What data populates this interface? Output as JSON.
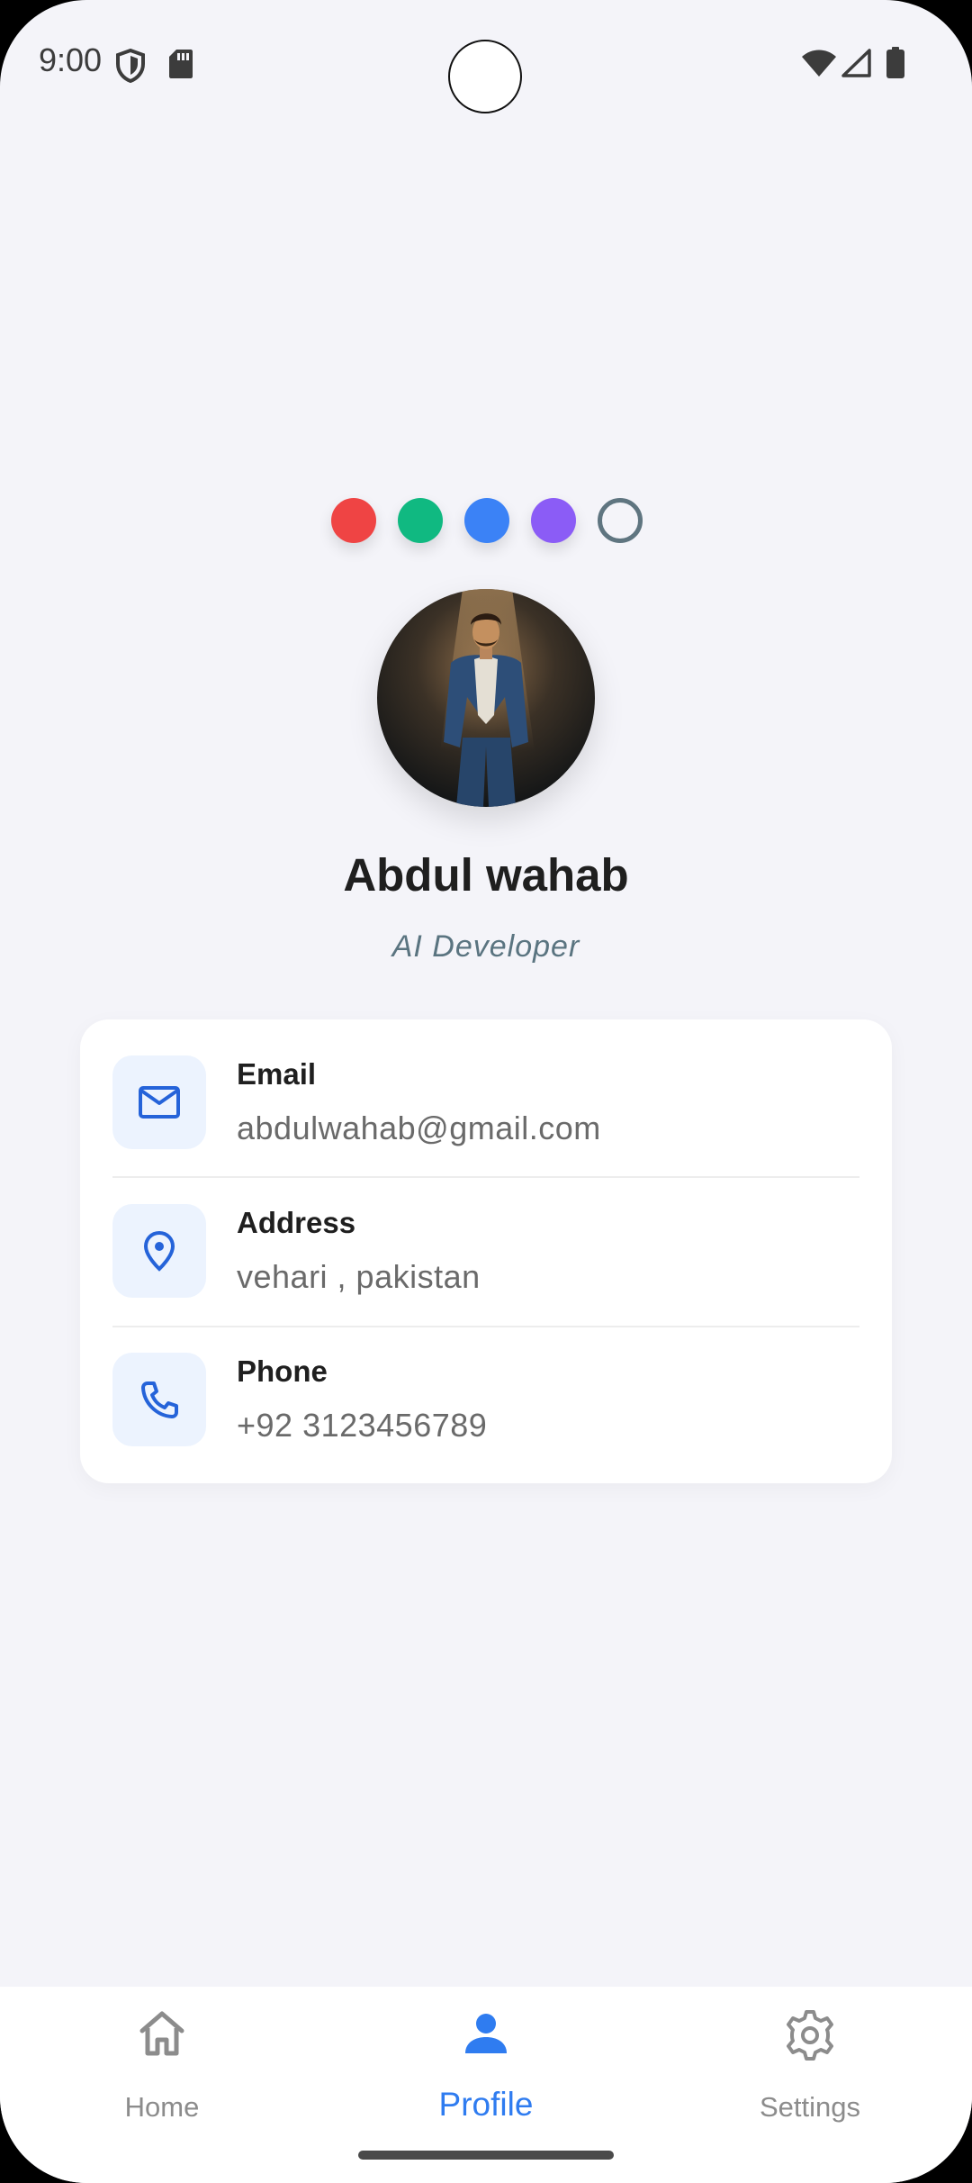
{
  "status_bar": {
    "time": "9:00",
    "left_icons": [
      "shield-icon",
      "sd-card-icon"
    ],
    "right_icons": [
      "wifi-icon",
      "signal-icon",
      "battery-icon"
    ]
  },
  "theme_colors": [
    {
      "name": "red",
      "hex": "#ef4444"
    },
    {
      "name": "green",
      "hex": "#10b981"
    },
    {
      "name": "blue",
      "hex": "#3b82f6"
    },
    {
      "name": "purple",
      "hex": "#8b5cf6"
    },
    {
      "name": "slate",
      "hex": "#5f7580",
      "style": "outline"
    }
  ],
  "profile": {
    "name": "Abdul wahab",
    "role": "AI Developer",
    "avatar": "person-portrait-photo"
  },
  "contact": {
    "email": {
      "label": "Email",
      "value": "abdulwahab@gmail.com",
      "icon": "mail-icon"
    },
    "address": {
      "label": "Address",
      "value": "vehari , pakistan",
      "icon": "location-pin-icon"
    },
    "phone": {
      "label": "Phone",
      "value": "+92 3123456789",
      "icon": "phone-icon"
    }
  },
  "nav": {
    "active": "profile",
    "items": [
      {
        "label": "Home",
        "icon": "home-icon"
      },
      {
        "label": "Profile",
        "icon": "person-icon"
      },
      {
        "label": "Settings",
        "icon": "gear-icon"
      }
    ]
  },
  "accent_color": "#2f7cf0"
}
